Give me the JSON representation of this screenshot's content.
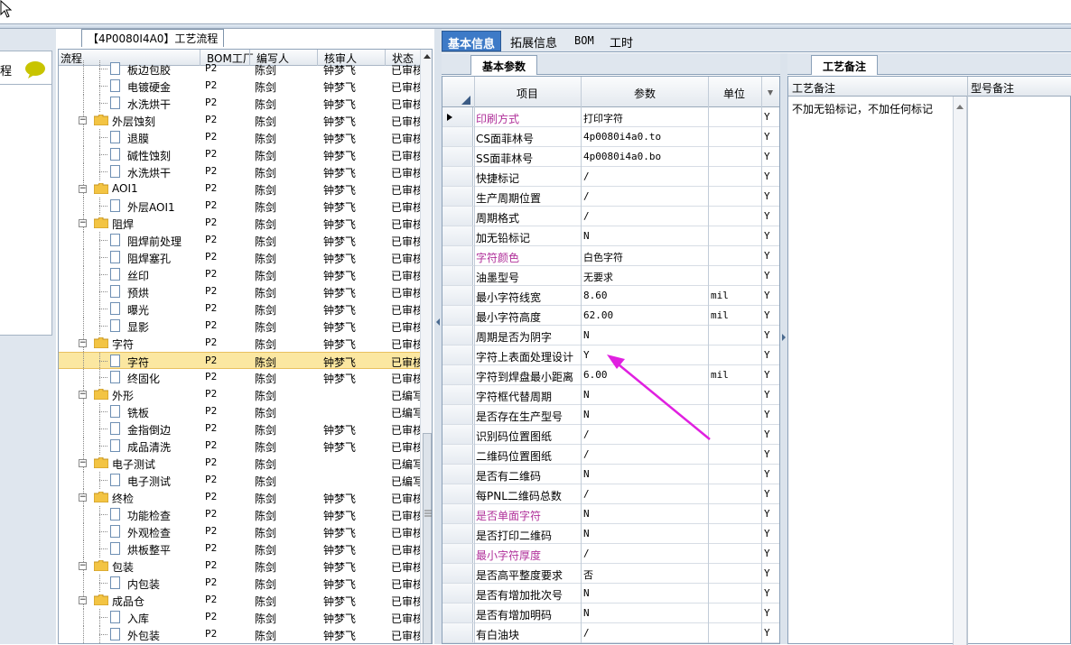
{
  "tree": {
    "tab_label": "【4P0080I4A0】工艺流程",
    "columns": [
      "流程",
      "BOM工厂",
      "编写人",
      "核审人",
      "状态"
    ],
    "rows": [
      {
        "level": 1,
        "type": "item",
        "name": "板边包胶",
        "bom": "P2",
        "writer": "陈剑",
        "reviewer": "钟梦飞",
        "status": "已审核"
      },
      {
        "level": 1,
        "type": "item",
        "name": "电镀硬金",
        "bom": "P2",
        "writer": "陈剑",
        "reviewer": "钟梦飞",
        "status": "已审核"
      },
      {
        "level": 1,
        "type": "item",
        "name": "水洗烘干",
        "bom": "P2",
        "writer": "陈剑",
        "reviewer": "钟梦飞",
        "status": "已审核"
      },
      {
        "level": 0,
        "type": "folder",
        "name": "外层蚀刻",
        "bom": "P2",
        "writer": "陈剑",
        "reviewer": "钟梦飞",
        "status": "已审核"
      },
      {
        "level": 1,
        "type": "item",
        "name": "退膜",
        "bom": "P2",
        "writer": "陈剑",
        "reviewer": "钟梦飞",
        "status": "已审核"
      },
      {
        "level": 1,
        "type": "item",
        "name": "碱性蚀刻",
        "bom": "P2",
        "writer": "陈剑",
        "reviewer": "钟梦飞",
        "status": "已审核"
      },
      {
        "level": 1,
        "type": "item",
        "name": "水洗烘干",
        "bom": "P2",
        "writer": "陈剑",
        "reviewer": "钟梦飞",
        "status": "已审核"
      },
      {
        "level": 0,
        "type": "folder",
        "name": "AOI1",
        "bom": "P2",
        "writer": "陈剑",
        "reviewer": "钟梦飞",
        "status": "已审核"
      },
      {
        "level": 1,
        "type": "item",
        "name": "外层AOI1",
        "bom": "P2",
        "writer": "陈剑",
        "reviewer": "钟梦飞",
        "status": "已审核"
      },
      {
        "level": 0,
        "type": "folder",
        "name": "阻焊",
        "bom": "P2",
        "writer": "陈剑",
        "reviewer": "钟梦飞",
        "status": "已审核"
      },
      {
        "level": 1,
        "type": "item",
        "name": "阻焊前处理",
        "bom": "P2",
        "writer": "陈剑",
        "reviewer": "钟梦飞",
        "status": "已审核"
      },
      {
        "level": 1,
        "type": "item",
        "name": "阻焊塞孔",
        "bom": "P2",
        "writer": "陈剑",
        "reviewer": "钟梦飞",
        "status": "已审核"
      },
      {
        "level": 1,
        "type": "item",
        "name": "丝印",
        "bom": "P2",
        "writer": "陈剑",
        "reviewer": "钟梦飞",
        "status": "已审核"
      },
      {
        "level": 1,
        "type": "item",
        "name": "预烘",
        "bom": "P2",
        "writer": "陈剑",
        "reviewer": "钟梦飞",
        "status": "已审核"
      },
      {
        "level": 1,
        "type": "item",
        "name": "曝光",
        "bom": "P2",
        "writer": "陈剑",
        "reviewer": "钟梦飞",
        "status": "已审核"
      },
      {
        "level": 1,
        "type": "item",
        "name": "显影",
        "bom": "P2",
        "writer": "陈剑",
        "reviewer": "钟梦飞",
        "status": "已审核"
      },
      {
        "level": 0,
        "type": "folder",
        "name": "字符",
        "bom": "P2",
        "writer": "陈剑",
        "reviewer": "钟梦飞",
        "status": "已审核"
      },
      {
        "level": 1,
        "type": "item",
        "name": "字符",
        "bom": "P2",
        "writer": "陈剑",
        "reviewer": "钟梦飞",
        "status": "已审核",
        "selected": true
      },
      {
        "level": 1,
        "type": "item",
        "name": "终固化",
        "bom": "P2",
        "writer": "陈剑",
        "reviewer": "钟梦飞",
        "status": "已审核"
      },
      {
        "level": 0,
        "type": "folder",
        "name": "外形",
        "bom": "P2",
        "writer": "陈剑",
        "reviewer": "",
        "status": "已编写"
      },
      {
        "level": 1,
        "type": "item",
        "name": "铣板",
        "bom": "P2",
        "writer": "陈剑",
        "reviewer": "",
        "status": "已编写"
      },
      {
        "level": 1,
        "type": "item",
        "name": "金指倒边",
        "bom": "P2",
        "writer": "陈剑",
        "reviewer": "钟梦飞",
        "status": "已审核"
      },
      {
        "level": 1,
        "type": "item",
        "name": "成品清洗",
        "bom": "P2",
        "writer": "陈剑",
        "reviewer": "钟梦飞",
        "status": "已审核"
      },
      {
        "level": 0,
        "type": "folder",
        "name": "电子测试",
        "bom": "P2",
        "writer": "陈剑",
        "reviewer": "",
        "status": "已编写"
      },
      {
        "level": 1,
        "type": "item",
        "name": "电子测试",
        "bom": "P2",
        "writer": "陈剑",
        "reviewer": "",
        "status": "已编写"
      },
      {
        "level": 0,
        "type": "folder",
        "name": "终检",
        "bom": "P2",
        "writer": "陈剑",
        "reviewer": "钟梦飞",
        "status": "已审核"
      },
      {
        "level": 1,
        "type": "item",
        "name": "功能检查",
        "bom": "P2",
        "writer": "陈剑",
        "reviewer": "钟梦飞",
        "status": "已审核"
      },
      {
        "level": 1,
        "type": "item",
        "name": "外观检查",
        "bom": "P2",
        "writer": "陈剑",
        "reviewer": "钟梦飞",
        "status": "已审核"
      },
      {
        "level": 1,
        "type": "item",
        "name": "烘板整平",
        "bom": "P2",
        "writer": "陈剑",
        "reviewer": "钟梦飞",
        "status": "已审核"
      },
      {
        "level": 0,
        "type": "folder",
        "name": "包装",
        "bom": "P2",
        "writer": "陈剑",
        "reviewer": "钟梦飞",
        "status": "已审核"
      },
      {
        "level": 1,
        "type": "item",
        "name": "内包装",
        "bom": "P2",
        "writer": "陈剑",
        "reviewer": "钟梦飞",
        "status": "已审核"
      },
      {
        "level": 0,
        "type": "folder",
        "name": "成品仓",
        "bom": "P2",
        "writer": "陈剑",
        "reviewer": "钟梦飞",
        "status": "已审核"
      },
      {
        "level": 1,
        "type": "item",
        "name": "入库",
        "bom": "P2",
        "writer": "陈剑",
        "reviewer": "钟梦飞",
        "status": "已审核"
      },
      {
        "level": 1,
        "type": "item",
        "name": "外包装",
        "bom": "P2",
        "writer": "陈剑",
        "reviewer": "钟梦飞",
        "status": "已审核"
      }
    ]
  },
  "stub": {
    "label": "程"
  },
  "tabs": [
    "基本信息",
    "拓展信息",
    "BOM",
    "工时"
  ],
  "params": {
    "subtab": "基本参数",
    "columns": [
      "项目",
      "参数",
      "单位"
    ],
    "rows": [
      {
        "item": "印刷方式",
        "value": "打印字符",
        "unit": "",
        "flag": "Y",
        "pink": true,
        "current": true
      },
      {
        "item": "CS面菲林号",
        "value": "4p0080i4a0.to",
        "unit": "",
        "flag": "Y"
      },
      {
        "item": "SS面菲林号",
        "value": "4p0080i4a0.bo",
        "unit": "",
        "flag": "Y"
      },
      {
        "item": "快捷标记",
        "value": "/",
        "unit": "",
        "flag": "Y"
      },
      {
        "item": "生产周期位置",
        "value": "/",
        "unit": "",
        "flag": "Y"
      },
      {
        "item": "周期格式",
        "value": "/",
        "unit": "",
        "flag": "Y"
      },
      {
        "item": "加无铅标记",
        "value": "N",
        "unit": "",
        "flag": "Y"
      },
      {
        "item": "字符颜色",
        "value": "白色字符",
        "unit": "",
        "flag": "Y",
        "pink": true
      },
      {
        "item": "油墨型号",
        "value": "无要求",
        "unit": "",
        "flag": "Y"
      },
      {
        "item": "最小字符线宽",
        "value": "8.60",
        "unit": "mil",
        "flag": "Y"
      },
      {
        "item": "最小字符高度",
        "value": "62.00",
        "unit": "mil",
        "flag": "Y"
      },
      {
        "item": "周期是否为阴字",
        "value": "N",
        "unit": "",
        "flag": "Y"
      },
      {
        "item": "字符上表面处理设计",
        "value": "Y",
        "unit": "",
        "flag": "Y"
      },
      {
        "item": "字符到焊盘最小距离",
        "value": "6.00",
        "unit": "mil",
        "flag": "Y"
      },
      {
        "item": "字符框代替周期",
        "value": "N",
        "unit": "",
        "flag": "Y"
      },
      {
        "item": "是否存在生产型号",
        "value": "N",
        "unit": "",
        "flag": "Y"
      },
      {
        "item": "识别码位置图纸",
        "value": "/",
        "unit": "",
        "flag": "Y"
      },
      {
        "item": "二维码位置图纸",
        "value": "/",
        "unit": "",
        "flag": "Y"
      },
      {
        "item": "是否有二维码",
        "value": "N",
        "unit": "",
        "flag": "Y"
      },
      {
        "item": "每PNL二维码总数",
        "value": "/",
        "unit": "",
        "flag": "Y"
      },
      {
        "item": "是否单面字符",
        "value": "N",
        "unit": "",
        "flag": "Y",
        "pink": true
      },
      {
        "item": "是否打印二维码",
        "value": "N",
        "unit": "",
        "flag": "Y"
      },
      {
        "item": "最小字符厚度",
        "value": "/",
        "unit": "",
        "flag": "Y",
        "pink": true
      },
      {
        "item": "是否高平整度要求",
        "value": "否",
        "unit": "",
        "flag": "Y"
      },
      {
        "item": "是否有增加批次号",
        "value": "N",
        "unit": "",
        "flag": "Y"
      },
      {
        "item": "是否有增加明码",
        "value": "N",
        "unit": "",
        "flag": "Y"
      },
      {
        "item": "有白油块",
        "value": "/",
        "unit": "",
        "flag": "Y"
      }
    ]
  },
  "notes": {
    "tab": "工艺备注",
    "col1": "工艺备注",
    "col2": "型号备注",
    "text": "不加无铅标记，不加任何标记"
  },
  "colors": {
    "accent": "#3d7ac7",
    "pink_label": "#b0309a",
    "arrow": "#e020e0",
    "selected_row": "#fbe7a1"
  }
}
